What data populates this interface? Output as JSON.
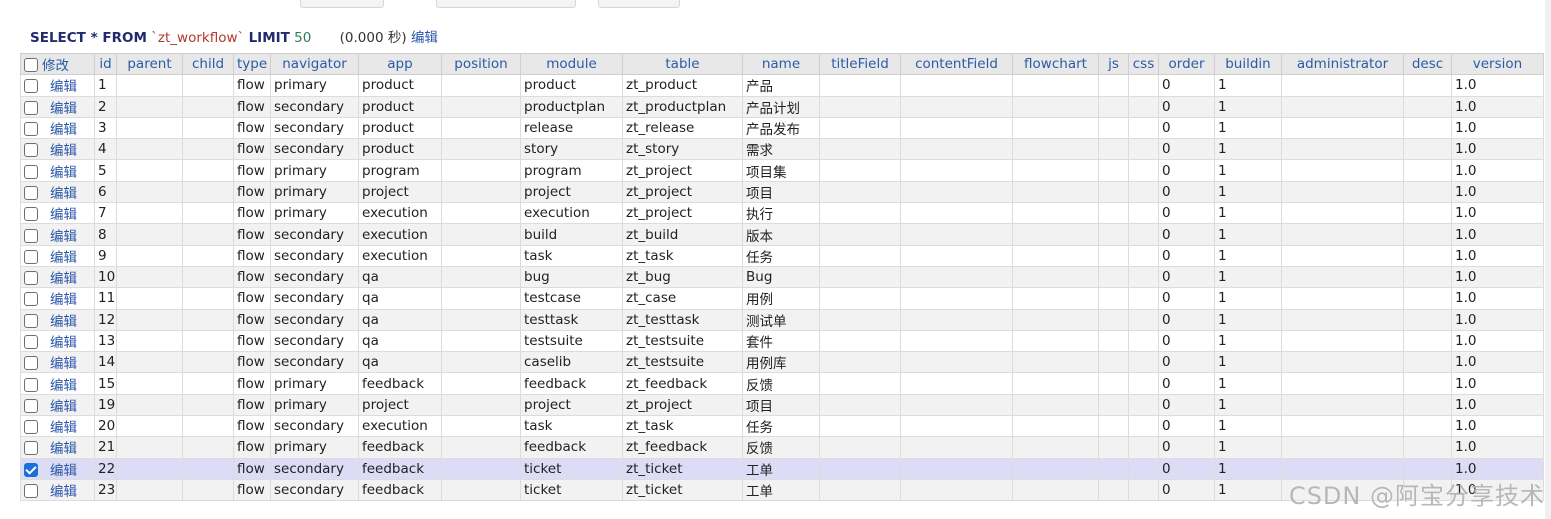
{
  "query": {
    "select_kw": "SELECT * FROM",
    "table_name": "`zt_workflow`",
    "limit_kw": "LIMIT",
    "limit_value": "50",
    "timing": "(0.000 秒)",
    "edit_link": "编辑"
  },
  "table": {
    "headers": [
      "修改",
      "id",
      "parent",
      "child",
      "type",
      "navigator",
      "app",
      "position",
      "module",
      "table",
      "name",
      "titleField",
      "contentField",
      "flowchart",
      "js",
      "css",
      "order",
      "buildin",
      "administrator",
      "desc",
      "version"
    ],
    "edit_label": "编辑",
    "rows": [
      {
        "checked": false,
        "id": "1",
        "type": "flow",
        "navigator": "primary",
        "app": "product",
        "module": "product",
        "table": "zt_product",
        "name": "产品",
        "order": "0",
        "buildin": "1",
        "version": "1.0"
      },
      {
        "checked": false,
        "id": "2",
        "type": "flow",
        "navigator": "secondary",
        "app": "product",
        "module": "productplan",
        "table": "zt_productplan",
        "name": "产品计划",
        "order": "0",
        "buildin": "1",
        "version": "1.0"
      },
      {
        "checked": false,
        "id": "3",
        "type": "flow",
        "navigator": "secondary",
        "app": "product",
        "module": "release",
        "table": "zt_release",
        "name": "产品发布",
        "order": "0",
        "buildin": "1",
        "version": "1.0"
      },
      {
        "checked": false,
        "id": "4",
        "type": "flow",
        "navigator": "secondary",
        "app": "product",
        "module": "story",
        "table": "zt_story",
        "name": "需求",
        "order": "0",
        "buildin": "1",
        "version": "1.0"
      },
      {
        "checked": false,
        "id": "5",
        "type": "flow",
        "navigator": "primary",
        "app": "program",
        "module": "program",
        "table": "zt_project",
        "name": "项目集",
        "order": "0",
        "buildin": "1",
        "version": "1.0"
      },
      {
        "checked": false,
        "id": "6",
        "type": "flow",
        "navigator": "primary",
        "app": "project",
        "module": "project",
        "table": "zt_project",
        "name": "项目",
        "order": "0",
        "buildin": "1",
        "version": "1.0"
      },
      {
        "checked": false,
        "id": "7",
        "type": "flow",
        "navigator": "primary",
        "app": "execution",
        "module": "execution",
        "table": "zt_project",
        "name": "执行",
        "order": "0",
        "buildin": "1",
        "version": "1.0"
      },
      {
        "checked": false,
        "id": "8",
        "type": "flow",
        "navigator": "secondary",
        "app": "execution",
        "module": "build",
        "table": "zt_build",
        "name": "版本",
        "order": "0",
        "buildin": "1",
        "version": "1.0"
      },
      {
        "checked": false,
        "id": "9",
        "type": "flow",
        "navigator": "secondary",
        "app": "execution",
        "module": "task",
        "table": "zt_task",
        "name": "任务",
        "order": "0",
        "buildin": "1",
        "version": "1.0"
      },
      {
        "checked": false,
        "id": "10",
        "type": "flow",
        "navigator": "secondary",
        "app": "qa",
        "module": "bug",
        "table": "zt_bug",
        "name": "Bug",
        "order": "0",
        "buildin": "1",
        "version": "1.0"
      },
      {
        "checked": false,
        "id": "11",
        "type": "flow",
        "navigator": "secondary",
        "app": "qa",
        "module": "testcase",
        "table": "zt_case",
        "name": "用例",
        "order": "0",
        "buildin": "1",
        "version": "1.0"
      },
      {
        "checked": false,
        "id": "12",
        "type": "flow",
        "navigator": "secondary",
        "app": "qa",
        "module": "testtask",
        "table": "zt_testtask",
        "name": "测试单",
        "order": "0",
        "buildin": "1",
        "version": "1.0"
      },
      {
        "checked": false,
        "id": "13",
        "type": "flow",
        "navigator": "secondary",
        "app": "qa",
        "module": "testsuite",
        "table": "zt_testsuite",
        "name": "套件",
        "order": "0",
        "buildin": "1",
        "version": "1.0"
      },
      {
        "checked": false,
        "id": "14",
        "type": "flow",
        "navigator": "secondary",
        "app": "qa",
        "module": "caselib",
        "table": "zt_testsuite",
        "name": "用例库",
        "order": "0",
        "buildin": "1",
        "version": "1.0"
      },
      {
        "checked": false,
        "id": "15",
        "type": "flow",
        "navigator": "primary",
        "app": "feedback",
        "module": "feedback",
        "table": "zt_feedback",
        "name": "反馈",
        "order": "0",
        "buildin": "1",
        "version": "1.0"
      },
      {
        "checked": false,
        "id": "19",
        "type": "flow",
        "navigator": "primary",
        "app": "project",
        "module": "project",
        "table": "zt_project",
        "name": "项目",
        "order": "0",
        "buildin": "1",
        "version": "1.0"
      },
      {
        "checked": false,
        "id": "20",
        "type": "flow",
        "navigator": "secondary",
        "app": "execution",
        "module": "task",
        "table": "zt_task",
        "name": "任务",
        "order": "0",
        "buildin": "1",
        "version": "1.0"
      },
      {
        "checked": false,
        "id": "21",
        "type": "flow",
        "navigator": "primary",
        "app": "feedback",
        "module": "feedback",
        "table": "zt_feedback",
        "name": "反馈",
        "order": "0",
        "buildin": "1",
        "version": "1.0"
      },
      {
        "checked": true,
        "id": "22",
        "type": "flow",
        "navigator": "secondary",
        "app": "feedback",
        "module": "ticket",
        "table": "zt_ticket",
        "name": "工单",
        "order": "0",
        "buildin": "1",
        "version": "1.0"
      },
      {
        "checked": false,
        "id": "23",
        "type": "flow",
        "navigator": "secondary",
        "app": "feedback",
        "module": "ticket",
        "table": "zt_ticket",
        "name": "工单",
        "order": "0",
        "buildin": "1",
        "version": "1.0"
      }
    ]
  },
  "watermark": "CSDN @阿宝分享技术",
  "colors": {
    "header_text": "#2b5ba8",
    "edit_link": "#2a56a8",
    "checkbox_checked": "#1b6fd8",
    "selected_row": "#dcdcf7"
  }
}
